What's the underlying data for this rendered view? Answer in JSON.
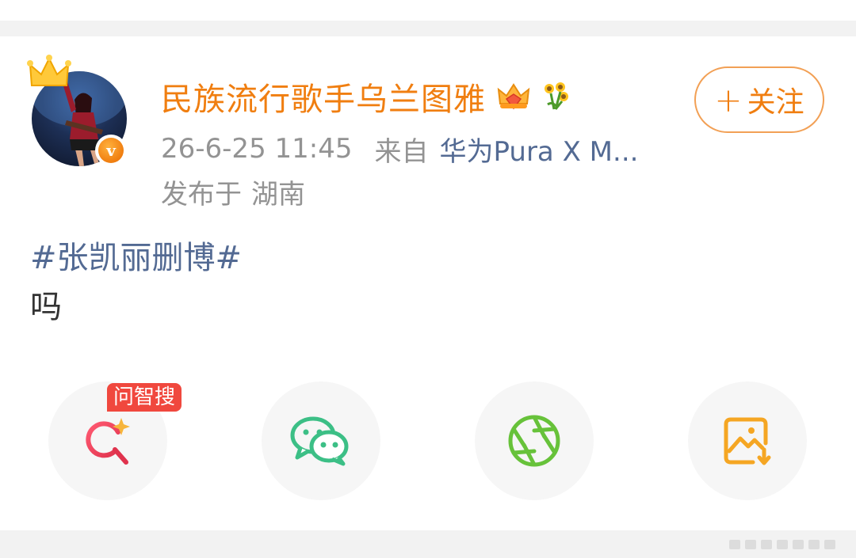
{
  "post": {
    "user_name": "民族流行歌手乌兰图雅",
    "timestamp": "26-6-25 11:45",
    "from_label": "来自",
    "device": "华为Pura X M...",
    "location_label": "发布于",
    "location": "湖南",
    "hashtag": "#张凯丽删博#",
    "text": "吗"
  },
  "follow_button": {
    "plus": "+",
    "label": "关注"
  },
  "actions": {
    "smart_search_tag": "问智搜",
    "items": [
      {
        "icon": "smart-search-icon"
      },
      {
        "icon": "wechat-icon"
      },
      {
        "icon": "moments-aperture-icon"
      },
      {
        "icon": "save-image-icon"
      }
    ]
  },
  "colors": {
    "brand_orange": "#f07e10",
    "link_blue": "#536a93",
    "meta_gray": "#939393",
    "tag_red": "#f0483e",
    "wechat_green": "#3cbf86",
    "moments_green": "#67c23a",
    "save_orange": "#f5a623"
  }
}
